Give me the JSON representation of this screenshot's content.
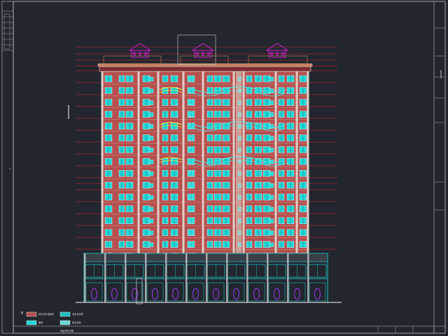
{
  "app": {
    "background": "#22262e",
    "frame_color": "#bfc3c8"
  },
  "drawing": {
    "type": "building-elevation",
    "floors": 20,
    "colors": {
      "brick": "#b5504f",
      "brick_dark": "#7e2e30",
      "window": "#1fd6d6",
      "window_frame": "#ffffff",
      "level_line": "#e0282c",
      "roof_pavilion": "#d21ed6",
      "balcony": "#e8ec3a",
      "railing": "#4ae0e0",
      "podium": "#1fbcbc",
      "arch": "#8c34d4",
      "wall_outline": "#f0f0f0"
    }
  },
  "legend": {
    "title": "图",
    "items": [
      {
        "swatch": "#b5504f",
        "label": "砖红色外墙涂料"
      },
      {
        "swatch": "#1fd6d6",
        "label": "玻璃"
      },
      {
        "swatch": "#1fbcbc",
        "label": "浅灰色涂料"
      },
      {
        "swatch": "#6cd4d4",
        "label": "铝合金窗"
      }
    ],
    "note": "饰面材料说明"
  },
  "title_block": {
    "right_col_labels": [
      "",
      "",
      "",
      "",
      "",
      ""
    ],
    "bottom_labels": [
      "",
      "",
      "",
      ""
    ]
  }
}
